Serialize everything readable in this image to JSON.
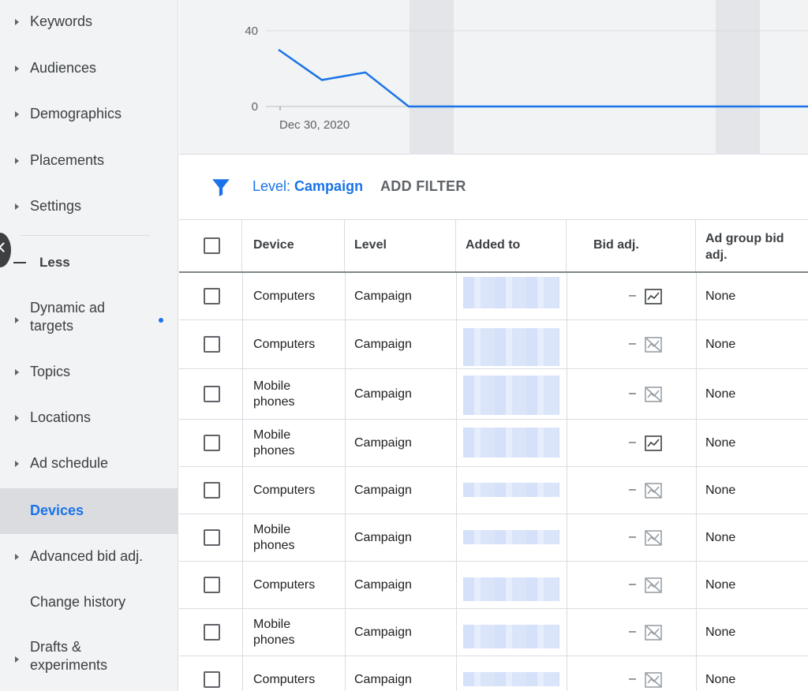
{
  "sidebar": {
    "items": [
      {
        "label": "Keywords",
        "arrow": true
      },
      {
        "label": "Audiences",
        "arrow": true
      },
      {
        "label": "Demographics",
        "arrow": true
      },
      {
        "label": "Placements",
        "arrow": true
      },
      {
        "label": "Settings",
        "arrow": true
      }
    ],
    "less_label": "Less",
    "more_items": [
      {
        "label": "Dynamic ad targets",
        "arrow": true,
        "dot": true
      },
      {
        "label": "Topics",
        "arrow": true
      },
      {
        "label": "Locations",
        "arrow": true
      },
      {
        "label": "Ad schedule",
        "arrow": true
      },
      {
        "label": "Devices",
        "arrow": false,
        "active": true
      },
      {
        "label": "Advanced bid adj.",
        "arrow": true
      },
      {
        "label": "Change history",
        "arrow": false
      },
      {
        "label": "Drafts & experiments",
        "arrow": true
      }
    ]
  },
  "chart_data": {
    "type": "line",
    "y_ticks": [
      "40",
      "0"
    ],
    "x_label_first": "Dec 30, 2020",
    "values": [
      30,
      14,
      18,
      0,
      0,
      0,
      0,
      0,
      0,
      0,
      0,
      0,
      0,
      0,
      0
    ],
    "ylim": [
      0,
      40
    ],
    "series_color": "#1a73e8"
  },
  "filter": {
    "level_prefix": "Level: ",
    "level_value": "Campaign",
    "add_filter_label": "ADD FILTER"
  },
  "table": {
    "headers": [
      "Device",
      "Level",
      "Added to",
      "Bid adj.",
      "Ad group bid adj."
    ],
    "rows": [
      {
        "device": "Computers",
        "level": "Campaign",
        "bid": "–",
        "bid_icon": "chart-icon",
        "ad_group_bid": "None"
      },
      {
        "device": "Computers",
        "level": "Campaign",
        "bid": "–",
        "bid_icon": "chart-off-icon",
        "ad_group_bid": "None"
      },
      {
        "device": "Mobile phones",
        "level": "Campaign",
        "bid": "–",
        "bid_icon": "chart-off-icon",
        "ad_group_bid": "None"
      },
      {
        "device": "Mobile phones",
        "level": "Campaign",
        "bid": "–",
        "bid_icon": "chart-icon",
        "ad_group_bid": "None"
      },
      {
        "device": "Computers",
        "level": "Campaign",
        "bid": "–",
        "bid_icon": "chart-off-icon",
        "ad_group_bid": "None"
      },
      {
        "device": "Mobile phones",
        "level": "Campaign",
        "bid": "–",
        "bid_icon": "chart-off-icon",
        "ad_group_bid": "None"
      },
      {
        "device": "Computers",
        "level": "Campaign",
        "bid": "–",
        "bid_icon": "chart-off-icon",
        "ad_group_bid": "None"
      },
      {
        "device": "Mobile phones",
        "level": "Campaign",
        "bid": "–",
        "bid_icon": "chart-off-icon",
        "ad_group_bid": "None"
      },
      {
        "device": "Computers",
        "level": "Campaign",
        "bid": "–",
        "bid_icon": "chart-off-icon",
        "ad_group_bid": "None"
      }
    ]
  }
}
